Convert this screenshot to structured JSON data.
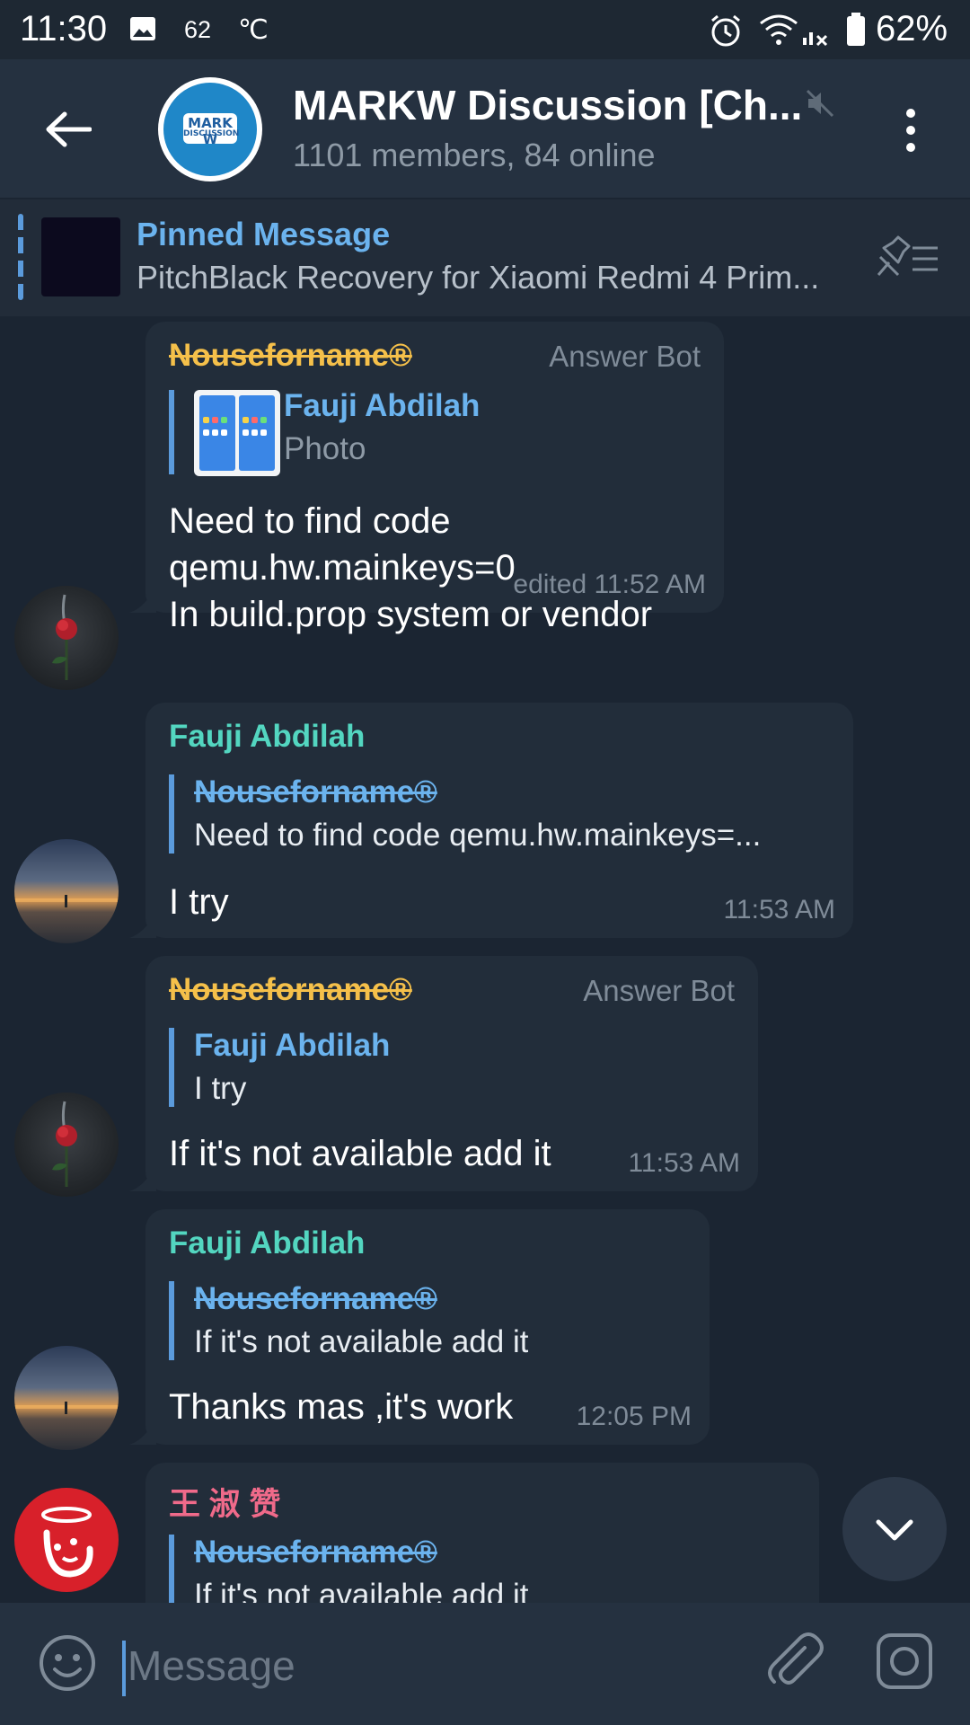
{
  "status_bar": {
    "time": "11:30",
    "temperature": "62",
    "temp_unit": "℃",
    "battery": "62%"
  },
  "header": {
    "title": "MARKW Discussion [Ch...",
    "subtitle": "1101 members, 84 online",
    "avatar_text_line1": "MARK W",
    "avatar_text_line2": "DISCUSSION"
  },
  "pinned": {
    "label": "Pinned Message",
    "text": "PitchBlack Recovery for Xiaomi Redmi 4 Prim..."
  },
  "messages": [
    {
      "sender": "Nouseforname®",
      "sender_color": "#f5c04a",
      "tag": "Answer Bot",
      "reply_name": "Fauji Abdilah",
      "reply_text": "Photo",
      "text": "Need to find code\nqemu.hw.mainkeys=0\nIn build.prop system or vendor",
      "time": "edited 11:52 AM"
    },
    {
      "sender": "Fauji Abdilah",
      "sender_color": "#53d6c0",
      "reply_name": "Nouseforname®",
      "reply_text": "Need to find code  qemu.hw.mainkeys=...",
      "text": "I try",
      "time": "11:53 AM"
    },
    {
      "sender": "Nouseforname®",
      "sender_color": "#f5c04a",
      "tag": "Answer Bot",
      "reply_name": "Fauji Abdilah",
      "reply_text": "I try",
      "text": "If it's not available add it",
      "time": "11:53 AM"
    },
    {
      "sender": "Fauji Abdilah",
      "sender_color": "#53d6c0",
      "reply_name": "Nouseforname®",
      "reply_text": "If it's not available add it",
      "text": "Thanks mas ,it's work",
      "time": "12:05 PM"
    },
    {
      "sender": "王 淑 赞",
      "sender_color": "#f06a8a",
      "reply_name": "Nouseforname®",
      "reply_text": "If it's not available add it"
    }
  ],
  "composer": {
    "placeholder": "Message"
  },
  "colors": {
    "accent": "#5b9bdc",
    "background": "#1b2532",
    "bubble": "#222d3a"
  }
}
